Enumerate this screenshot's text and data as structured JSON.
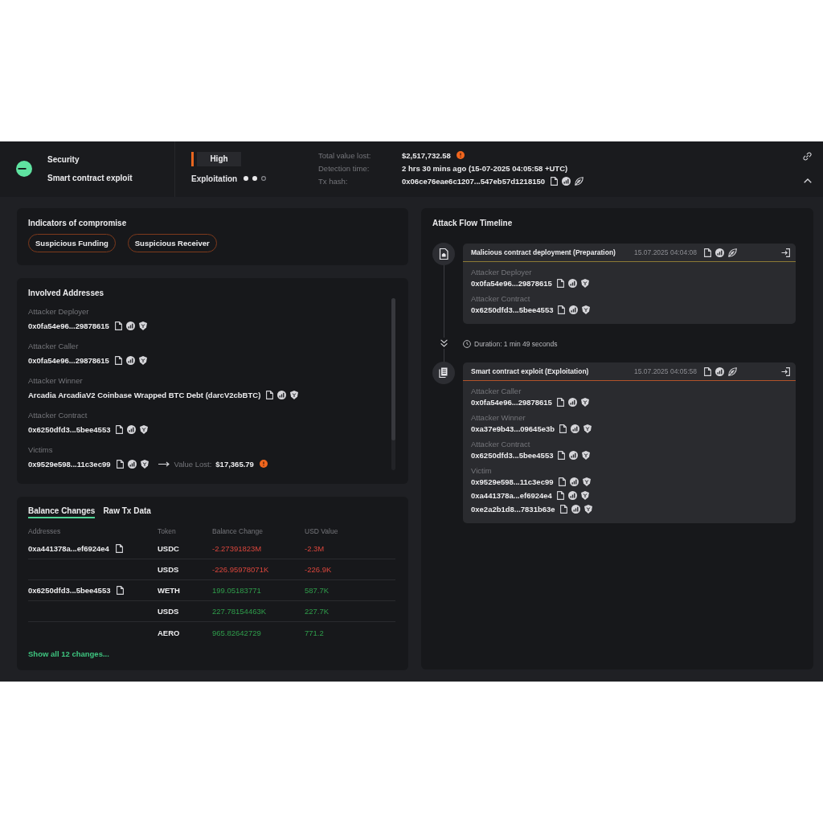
{
  "header": {
    "category": "Security",
    "title": "Smart contract exploit",
    "severity": "High",
    "stage": {
      "label": "Exploitation",
      "steps": [
        {
          "done": true
        },
        {
          "done": true
        },
        {
          "done": false
        }
      ]
    },
    "stats": [
      {
        "kind": "amount",
        "label": "Total value lost:",
        "value": "$2,517,732.58"
      },
      {
        "kind": "text",
        "label": "Detection time:",
        "value": "2 hrs 30 mins ago (15-07-2025 04:05:58 +UTC)"
      },
      {
        "kind": "hash",
        "label": "Tx hash:",
        "value": "0x06ce76eae6c1207...547eb57d1218150"
      }
    ],
    "expanded": true
  },
  "indicators": {
    "title": "Indicators of compromise",
    "tags": [
      "Suspicious Funding",
      "Suspicious Receiver"
    ]
  },
  "involved_addresses": {
    "title": "Involved Addresses",
    "groups": [
      {
        "label": "Attacker Deployer",
        "address": "0x0fa54e96...29878615"
      },
      {
        "label": "Attacker Caller",
        "address": "0x0fa54e96...29878615"
      },
      {
        "label": "Attacker Winner",
        "address": "Arcadia ArcadiaV2 Coinbase Wrapped BTC Debt (darcV2cbBTC)"
      },
      {
        "label": "Attacker Contract",
        "address": "0x6250dfd3...5bee4553"
      },
      {
        "label": "Victims",
        "address": "0x9529e598...11c3ec99",
        "value_lost_label": "Value Lost:",
        "value_lost": "$17,365.79"
      }
    ]
  },
  "balance_changes": {
    "tabs": [
      {
        "label": "Balance Changes",
        "selected": true
      },
      {
        "label": "Raw Tx Data",
        "selected": false
      }
    ],
    "columns": [
      "Addresses",
      "Token",
      "Balance Change",
      "USD Value"
    ],
    "rows": [
      {
        "address": "0xa441378a...ef6924e4",
        "token": "USDC",
        "change": "-2.27391823M",
        "usd": "-2.3M",
        "kind": "loss"
      },
      {
        "token": "USDS",
        "change": "-226.95978071K",
        "usd": "-226.9K",
        "kind": "loss"
      },
      {
        "address": "0x6250dfd3...5bee4553",
        "token": "WETH",
        "change": "199.05183771",
        "usd": "587.7K",
        "kind": "gain"
      },
      {
        "token": "USDS",
        "change": "227.78154463K",
        "usd": "227.7K",
        "kind": "gain"
      },
      {
        "token": "AERO",
        "change": "965.82642729",
        "usd": "771.2",
        "kind": "gain"
      }
    ],
    "show_all": "Show all 12 changes..."
  },
  "timeline": {
    "title": "Attack Flow Timeline",
    "items": [
      {
        "kind": "deployment",
        "title": "Malicious contract deployment (Preparation)",
        "time": "15.07.2025 04:04:08",
        "color": "#8c7a35",
        "groups": [
          {
            "label": "Attacker Deployer",
            "addresses": [
              "0x0fa54e96...29878615"
            ]
          },
          {
            "label": "Attacker Contract",
            "addresses": [
              "0x6250dfd3...5bee4553"
            ]
          }
        ]
      },
      {
        "kind": "duration",
        "text": "Duration: 1 min 49 seconds"
      },
      {
        "kind": "exploit",
        "title": "Smart contract exploit (Exploitation)",
        "time": "15.07.2025 04:05:58",
        "color": "#b0532a",
        "groups": [
          {
            "label": "Attacker Caller",
            "addresses": [
              "0x0fa54e96...29878615"
            ]
          },
          {
            "label": "Attacker Winner",
            "addresses": [
              "0xa37e9b43...09645e3b"
            ]
          },
          {
            "label": "Attacker Contract",
            "addresses": [
              "0x6250dfd3...5bee4553"
            ]
          },
          {
            "label": "Victim",
            "addresses": [
              "0x9529e598...11c3ec99",
              "0xa441378a...ef6924e4",
              "0xe2a2b1d8...7831b63e"
            ]
          }
        ]
      }
    ]
  }
}
